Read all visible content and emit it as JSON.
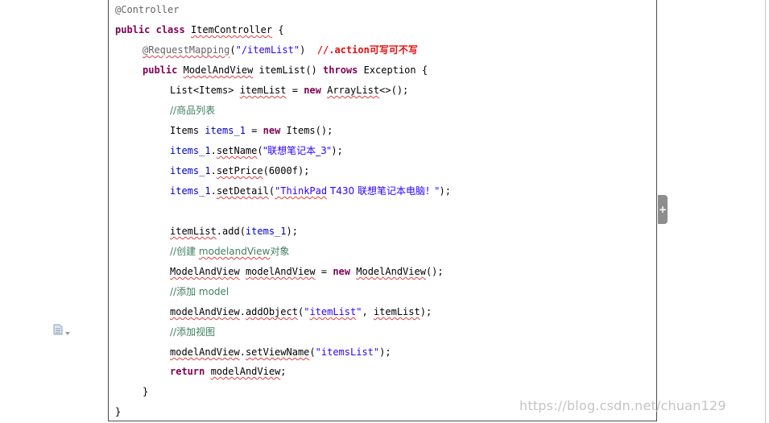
{
  "code": {
    "l1_annotation": "@Controller",
    "l2_public": "public",
    "l2_class": "class",
    "l2_name": "ItemController",
    "l2_brace": " {",
    "l3_annotation": "@RequestMapping",
    "l3_open": "(",
    "l3_path": "\"/itemList\"",
    "l3_close": ")",
    "l3_note": "//.action",
    "l3_note_cn": "可写可不写",
    "l4_public": "public",
    "l4_type": "ModelAndView",
    "l4_method": "itemList",
    "l4_parens": "() ",
    "l4_throws": "throws",
    "l4_rest": " Exception {",
    "l5_type": "List<Items> ",
    "l5_var": "itemList",
    "l5_eq": " = ",
    "l5_new": "new",
    "l5_cls": "ArrayList",
    "l5_rest": "<>();",
    "l6_comment": "//商品列表",
    "l7_type": "Items ",
    "l7_var": "items_1",
    "l7_eq": " = ",
    "l7_new": "new",
    "l7_rest": " Items();",
    "l8_var": "items_1",
    "l8_dot": ".",
    "l8_method": "setName",
    "l8_open": "(",
    "l8_str": "\"联想笔记本_3\"",
    "l8_close": ");",
    "l9_var": "items_1",
    "l9_dot": ".",
    "l9_method": "setPrice",
    "l9_rest": "(6000f);",
    "l10_var": "items_1",
    "l10_dot": ".",
    "l10_method": "setDetail",
    "l10_open": "(",
    "l10_str_a": "\"ThinkPad",
    "l10_str_b": " T430 联想笔记本电脑！\"",
    "l10_close": ");",
    "l11_var": "itemList",
    "l11_call": ".add(",
    "l11_arg": "items_1",
    "l11_close": ");",
    "l12_comment_a": "//创建 ",
    "l12_comment_b": "modelandView",
    "l12_comment_c": "对象",
    "l13_type": "ModelAndView",
    "l13_sp": " ",
    "l13_var": "modelAndView",
    "l13_eq": " = ",
    "l13_new": "new",
    "l13_sp2": " ",
    "l13_cls": "ModelAndView",
    "l13_rest": "();",
    "l14_comment": "//添加 model",
    "l15_var": "modelAndView",
    "l15_dot": ".",
    "l15_method": "addObject",
    "l15_open": "(",
    "l15_str_q1": "\"",
    "l15_str": "itemList",
    "l15_str_q2": "\"",
    "l15_comma": ", ",
    "l15_arg": "itemList",
    "l15_close": ");",
    "l16_comment": "//添加视图",
    "l17_var": "modelAndView",
    "l17_dot": ".",
    "l17_method": "setViewName",
    "l17_open": "(",
    "l17_str": "\"itemsList\"",
    "l17_close": ");",
    "l18_return": "return",
    "l18_sp": " ",
    "l18_var": "modelAndView",
    "l18_semi": ";",
    "l19_brace": "}",
    "l20_brace": "}"
  },
  "side_tab": {
    "label": "+"
  },
  "watermark": "https://blog.csdn.net/chuan129",
  "icons": {
    "side_tab": "expand-icon",
    "doc_menu": "document-icon",
    "menu_arrow": "dropdown-arrow-icon"
  },
  "colors": {
    "keyword": "#7f0055",
    "string": "#2a00ff",
    "comment": "#3f7f5f",
    "annotation": "#646464",
    "highlight": "#e01010"
  }
}
